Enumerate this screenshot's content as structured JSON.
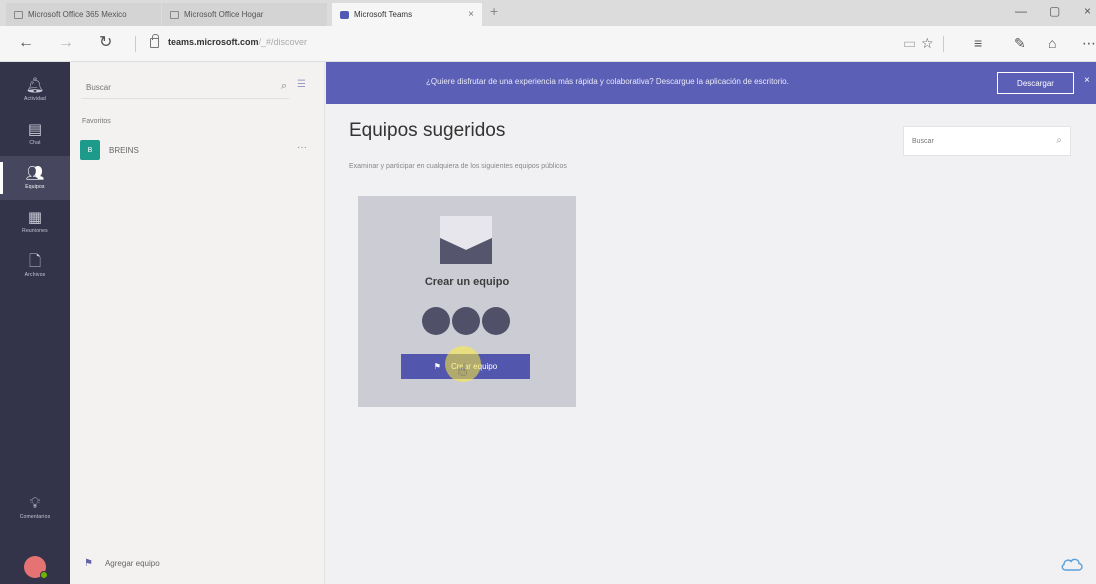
{
  "browser": {
    "tabs": [
      {
        "label": "Microsoft Office 365 Mexico"
      },
      {
        "label": "Microsoft Office Hogar"
      },
      {
        "label": "Microsoft Teams",
        "close": "×"
      }
    ],
    "new_tab": "+",
    "url_domain": "teams.microsoft.com",
    "url_rest": "/_#/discover",
    "window_controls": [
      "—",
      "▢",
      "×"
    ]
  },
  "rail": {
    "items": [
      {
        "label": "Actividad",
        "icon": "bell-icon"
      },
      {
        "label": "Chat",
        "icon": "chat-icon"
      },
      {
        "label": "Equipos",
        "icon": "teams-icon",
        "active": true
      },
      {
        "label": "Reuniones",
        "icon": "calendar-icon"
      },
      {
        "label": "Archivos",
        "icon": "file-icon"
      }
    ],
    "bottom_label": "Comentarios"
  },
  "list": {
    "search_placeholder": "Buscar",
    "favorites_label": "Favoritos",
    "team": {
      "initial": "B",
      "name": "BREINS",
      "more": "···"
    },
    "add_team": "Agregar equipo"
  },
  "banner": {
    "text": "¿Quiere disfrutar de una experiencia más rápida y colaborativa? Descargue la aplicación de escritorio.",
    "button": "Descargar",
    "close": "×"
  },
  "main": {
    "title": "Equipos sugeridos",
    "subtitle": "Examinar y participar en cualquiera de los siguientes equipos públicos",
    "search_placeholder": "Buscar",
    "card": {
      "title": "Crear un equipo",
      "button": "Crear equipo"
    }
  },
  "colors": {
    "rail": "#33344a",
    "brand": "#5b5fb6",
    "team_badge": "#1e9a8a"
  }
}
